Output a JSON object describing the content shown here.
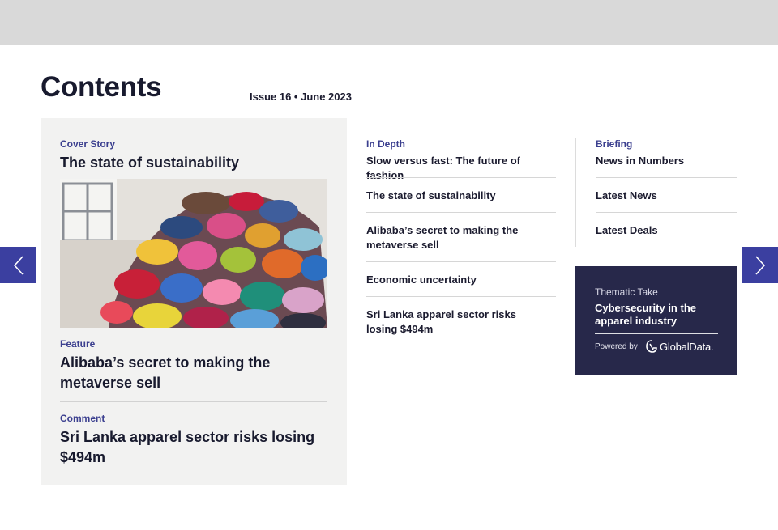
{
  "header": {
    "title": "Contents",
    "issue": "Issue 16 • June 2023"
  },
  "featured": {
    "cover": {
      "kicker": "Cover Story",
      "headline": "The state of sustainability"
    },
    "feature": {
      "kicker": "Feature",
      "headline": "Alibaba’s secret to making the metaverse sell"
    },
    "comment": {
      "kicker": "Comment",
      "headline": "Sri Lanka apparel sector risks losing $494m"
    }
  },
  "in_depth": {
    "kicker": "In Depth",
    "items": [
      "Slow versus fast: The future of fashion",
      "The state of sustainability",
      "Alibaba’s secret to making the metaverse sell",
      "Economic uncertainty",
      "Sri Lanka apparel sector risks losing $494m"
    ]
  },
  "briefing": {
    "kicker": "Briefing",
    "items": [
      "News in Numbers",
      "Latest News",
      "Latest Deals"
    ]
  },
  "thematic": {
    "kicker": "Thematic Take",
    "title": "Cybersecurity in the apparel industry",
    "powered_by": "Powered by",
    "brand": "GlobalData."
  },
  "nav": {
    "prev_icon": "chevron-left-icon",
    "next_icon": "chevron-right-icon"
  },
  "colors": {
    "accent": "#3b3fa0",
    "kicker": "#3b3f8f",
    "thematic_bg": "#27284a",
    "topbar": "#d9d9d9",
    "card_bg": "#f2f2f1"
  }
}
